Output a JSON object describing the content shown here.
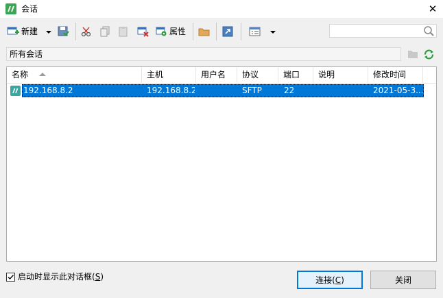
{
  "window": {
    "title": "会话",
    "close_glyph": "✕"
  },
  "toolbar": {
    "new_label": "新建",
    "properties_label": "属性",
    "icons": [
      "new-session-icon",
      "dropdown-arrow-icon",
      "save-session-icon",
      "cut-icon",
      "copy-icon",
      "paste-icon",
      "delete-icon",
      "properties-icon",
      "new-folder-icon",
      "shortcut-icon",
      "view-icon",
      "dropdown-arrow-icon"
    ]
  },
  "search": {
    "placeholder": ""
  },
  "path": {
    "text": "所有会话"
  },
  "list": {
    "columns": [
      {
        "label": "名称",
        "sorted": "ascending"
      },
      {
        "label": "主机"
      },
      {
        "label": "用户名"
      },
      {
        "label": "协议"
      },
      {
        "label": "端口"
      },
      {
        "label": "说明"
      },
      {
        "label": "修改时间"
      }
    ],
    "rows": [
      {
        "name": "192.168.8.2",
        "host": "192.168.8.2",
        "user": "",
        "protocol": "SFTP",
        "port": "22",
        "description": "",
        "modified": "2021-05-3...",
        "selected": true
      }
    ]
  },
  "footer": {
    "startup_checkbox_checked": true,
    "startup_label_prefix": "启动时显示此对话框(",
    "startup_label_key": "S",
    "startup_label_suffix": ")",
    "connect_prefix": "连接(",
    "connect_key": "C",
    "connect_suffix": ")",
    "close_label": "关闭"
  },
  "colors": {
    "selection": "#0078d7",
    "accent_green": "#2a9d3e"
  }
}
